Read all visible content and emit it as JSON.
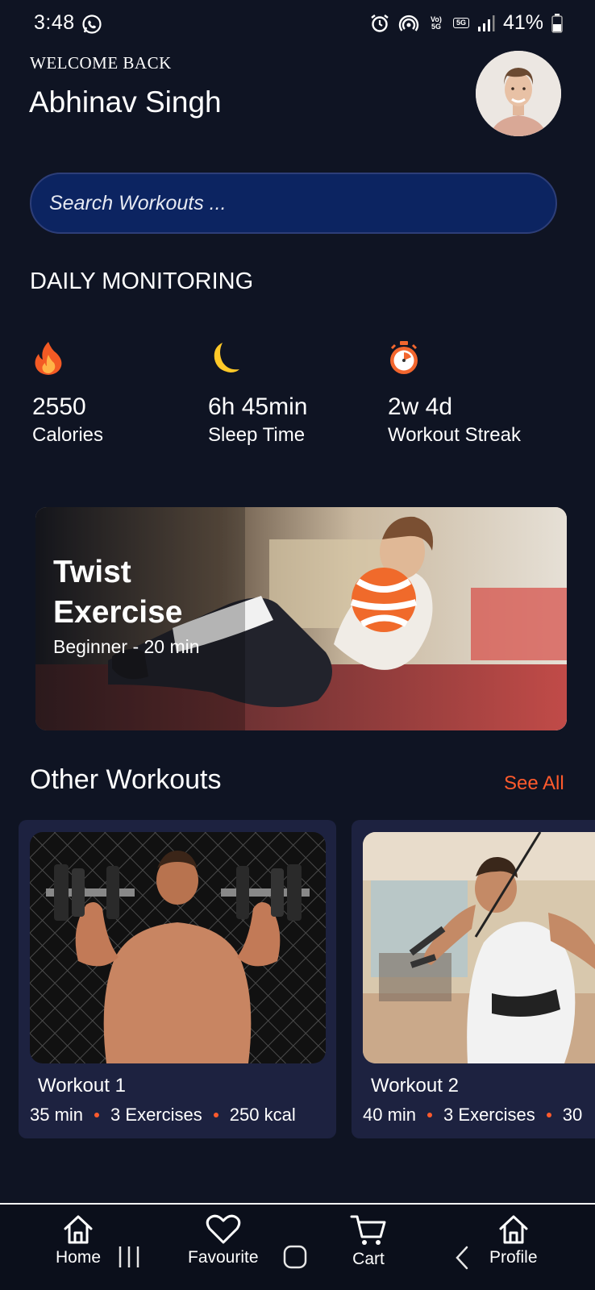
{
  "status": {
    "time": "3:48",
    "network": "Vo) 5G",
    "net_5g": "5G",
    "battery": "41%"
  },
  "header": {
    "welcome": "WELCOME BACK",
    "name": "Abhinav Singh"
  },
  "search": {
    "placeholder": "Search Workouts ..."
  },
  "daily": {
    "title": "DAILY MONITORING",
    "stats": [
      {
        "icon": "fire-icon",
        "value": "2550",
        "label": "Calories"
      },
      {
        "icon": "moon-icon",
        "value": "6h 45min",
        "label": "Sleep Time"
      },
      {
        "icon": "stopwatch-icon",
        "value": "2w 4d",
        "label": "Workout Streak"
      }
    ]
  },
  "featured": {
    "title_line1": "Twist",
    "title_line2": "Exercise",
    "subtitle": "Beginner - 20 min"
  },
  "other": {
    "title": "Other Workouts",
    "see_all": "See All",
    "workouts": [
      {
        "name": "Workout 1",
        "duration": "35 min",
        "exercises": "3 Exercises",
        "kcal": "250 kcal"
      },
      {
        "name": "Workout 2",
        "duration": "40 min",
        "exercises": "3 Exercises",
        "kcal": "30"
      }
    ]
  },
  "nav": {
    "items": [
      {
        "label": "Home",
        "icon": "home-icon"
      },
      {
        "label": "Favourite",
        "icon": "heart-icon"
      },
      {
        "label": "Cart",
        "icon": "cart-icon"
      },
      {
        "label": "Profile",
        "icon": "home-icon"
      }
    ]
  },
  "colors": {
    "background": "#0f1423",
    "accent": "#ff5a2c",
    "search_bg": "#0c2461",
    "card_bg": "#1d2240"
  }
}
